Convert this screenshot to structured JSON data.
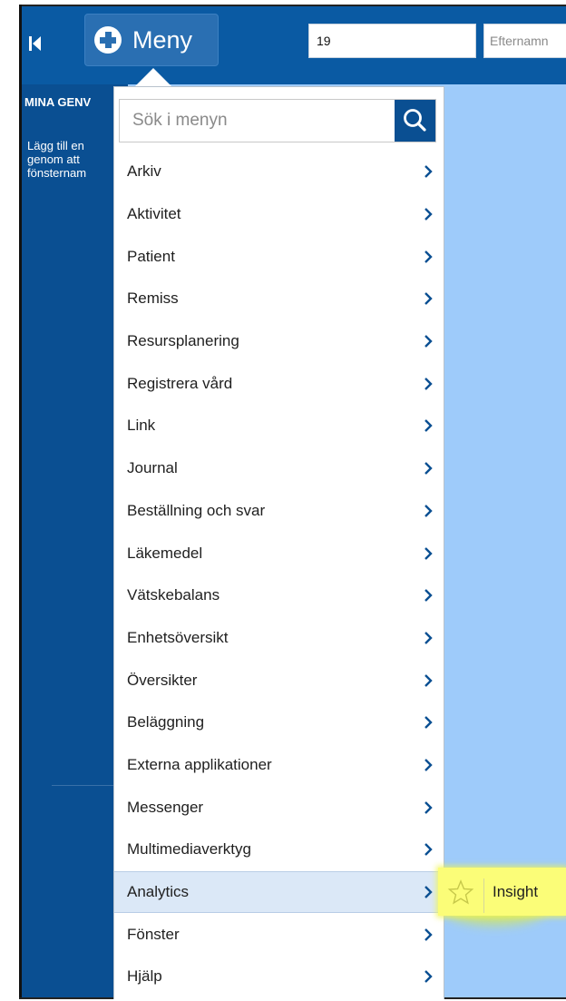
{
  "toolbar": {
    "menu_label": "Meny",
    "field_value": "19",
    "efternamn_placeholder": "Efternamn"
  },
  "sidebar": {
    "title": "MINA GENV",
    "text_lines": [
      "Lägg till en",
      "genom att",
      "fönsternam"
    ]
  },
  "menu": {
    "search_placeholder": "Sök i menyn",
    "items": [
      {
        "label": "Arkiv"
      },
      {
        "label": "Aktivitet"
      },
      {
        "label": "Patient"
      },
      {
        "label": "Remiss"
      },
      {
        "label": "Resursplanering"
      },
      {
        "label": "Registrera vård"
      },
      {
        "label": "Link"
      },
      {
        "label": "Journal"
      },
      {
        "label": "Beställning och svar"
      },
      {
        "label": "Läkemedel"
      },
      {
        "label": "Vätskebalans"
      },
      {
        "label": "Enhetsöversikt"
      },
      {
        "label": "Översikter"
      },
      {
        "label": "Beläggning"
      },
      {
        "label": "Externa applikationer"
      },
      {
        "label": "Messenger"
      },
      {
        "label": "Multimediaverktyg"
      },
      {
        "label": "Analytics"
      },
      {
        "label": "Fönster"
      },
      {
        "label": "Hjälp"
      }
    ],
    "active_item": "Analytics"
  },
  "submenu": {
    "label": "Insight",
    "highlight_color": "#fbfd78"
  },
  "colors": {
    "toolbar": "#0a5aa3",
    "sidebar": "#0a4f92",
    "workspace": "#9ecbfa",
    "active_item": "#dbe8f7"
  }
}
